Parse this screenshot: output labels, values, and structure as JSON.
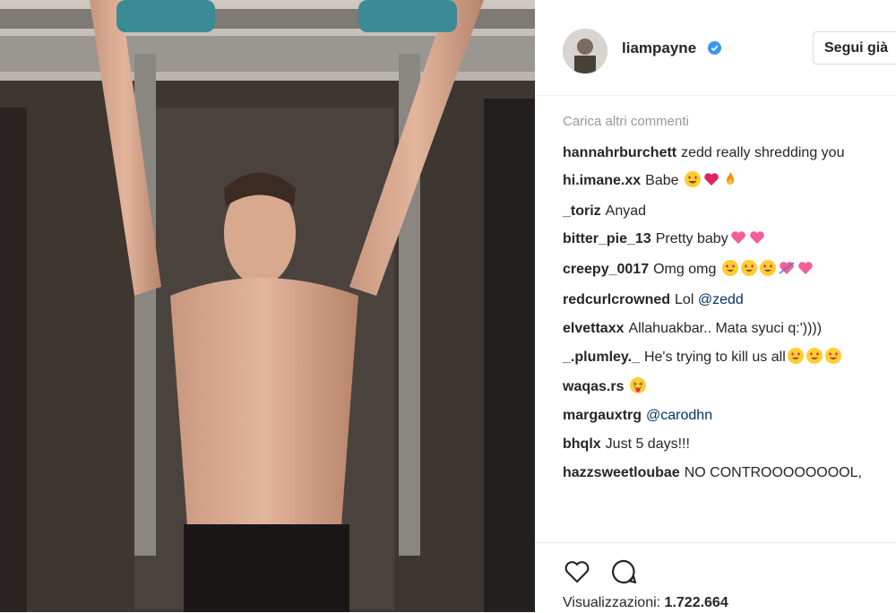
{
  "post": {
    "username": "liampayne",
    "follow_label": "Segui già",
    "load_more": "Carica altri commenti",
    "views_label": "Visualizzazioni:",
    "views_value": "1.722.664"
  },
  "comments": [
    {
      "user": "hannahrburchett",
      "text": "zedd really shredding you"
    },
    {
      "user": "hi.imane.xx",
      "text": "Babe ",
      "emoji": [
        "heart-eyes-emoji",
        "red-heart-emoji",
        "fire-emoji"
      ]
    },
    {
      "user": "_toriz",
      "text": "Anyad"
    },
    {
      "user": "bitter_pie_13",
      "text": "Pretty baby",
      "emoji": [
        "sparkling-heart-emoji",
        "sparkling-heart-emoji"
      ]
    },
    {
      "user": "creepy_0017",
      "text": "Omg omg ",
      "emoji": [
        "heart-eyes-emoji",
        "heart-eyes-emoji",
        "heart-eyes-emoji",
        "heart-arrow-emoji",
        "sparkling-heart-emoji"
      ]
    },
    {
      "user": "redcurlcrowned",
      "text": "Lol ",
      "mention": "@zedd"
    },
    {
      "user": "elvettaxx",
      "text": "Allahuakbar.. Mata syuci q:'))))"
    },
    {
      "user": "_.plumley._",
      "text": "He's trying to kill us all",
      "emoji": [
        "heart-eyes-emoji",
        "heart-eyes-emoji",
        "heart-eyes-emoji"
      ]
    },
    {
      "user": "waqas.rs",
      "text": "",
      "emoji": [
        "tongue-wink-emoji"
      ]
    },
    {
      "user": "margauxtrg",
      "text": "",
      "mention": "@carodhn"
    },
    {
      "user": "bhqlx",
      "text": "Just 5 days!!!"
    },
    {
      "user": "hazzsweetloubae",
      "text": "NO CONTROOOOOOOOL,"
    }
  ],
  "colors": {
    "verified": "#3897f0",
    "mention": "#003569",
    "muted": "#999999"
  }
}
